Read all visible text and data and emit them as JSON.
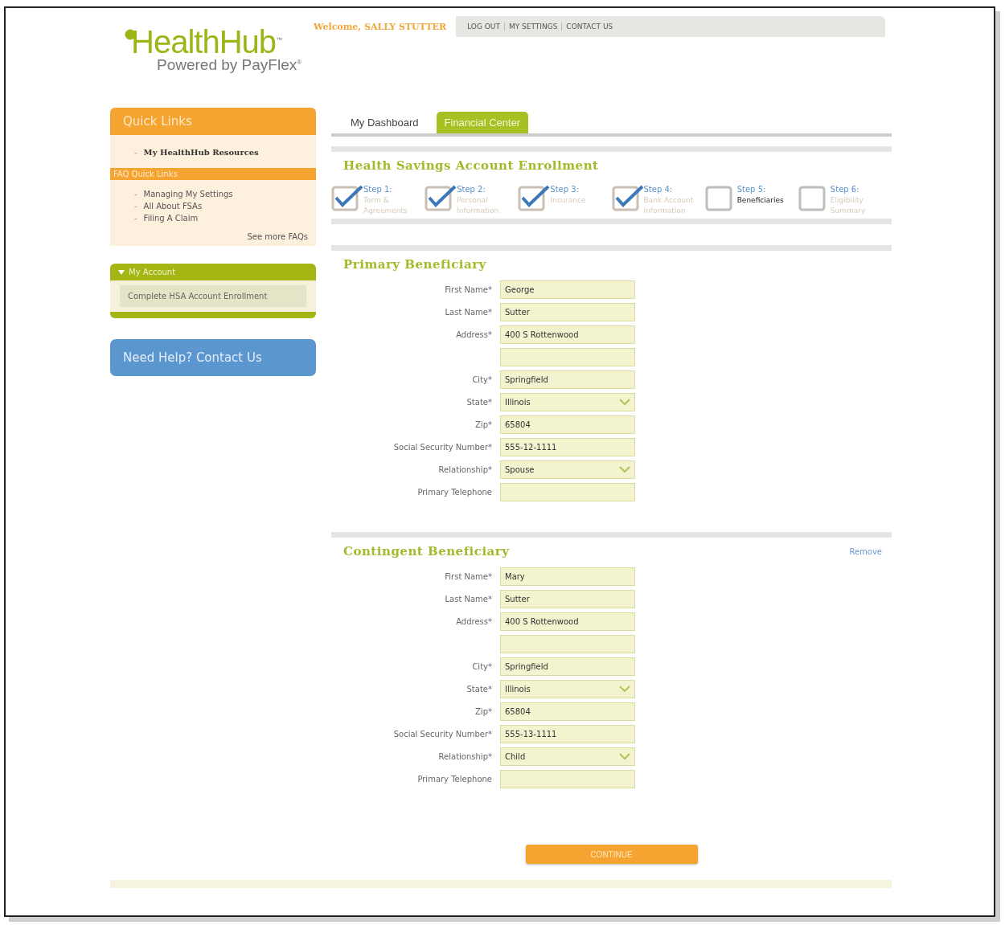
{
  "header": {
    "logo": "HealthHub$^{™}$",
    "tagline": "Powered by PayFlex$^{®}$",
    "welcome": "Welcome, SALLY STUTTER",
    "links": [
      "LOG OUT",
      "MY SETTINGS",
      "CONTACT US"
    ]
  },
  "tabs": [
    {
      "label": "My Dashboard",
      "selected": false
    },
    {
      "label": "Financial Center",
      "selected": true
    }
  ],
  "sidebar": {
    "quick_links": {
      "title": "Quick Links",
      "marker": "-",
      "items": [
        "My HealthHub Resources"
      ],
      "faq_title": "FAQ Quick Links",
      "faq_items": [
        "Managing My Settings",
        "All About FSAs",
        "Filing A Claim"
      ],
      "more": "See more FAQs"
    },
    "my_account": {
      "title": "My Account",
      "expanded": true,
      "items": [
        "Complete HSA Account Enrollment"
      ]
    },
    "help": "Need Help? Contact Us"
  },
  "enrollment": {
    "title": "Health Savings Account Enrollment",
    "steps": [
      {
        "title": "Step 1:",
        "label": "Term & Agreements",
        "checked": true,
        "selected": false
      },
      {
        "title": "Step 2:",
        "label": "Personal Information",
        "checked": true,
        "selected": false
      },
      {
        "title": "Step 3:",
        "label": "Insurance",
        "checked": true,
        "selected": false
      },
      {
        "title": "Step 4:",
        "label": "Bank Account Information",
        "checked": true,
        "selected": false
      },
      {
        "title": "Step 5:",
        "label": "Beneficiaries",
        "checked": false,
        "selected": true
      },
      {
        "title": "Step 6:",
        "label": "Eligibility Summary",
        "checked": false,
        "selected": false
      }
    ]
  },
  "sections": [
    {
      "title": "Primary Beneficiary",
      "fields": [
        {
          "label": "First Name*",
          "kind": "text",
          "value": "George"
        },
        {
          "label": "Last Name*",
          "kind": "text",
          "value": "Sutter"
        },
        {
          "label": "Address*",
          "kind": "text",
          "value": "400 S Rottenwood"
        },
        {
          "kind": "text"
        },
        {
          "label": "City*",
          "kind": "text",
          "value": "Springfield"
        },
        {
          "label": "State*",
          "kind": "select",
          "value": "Illinois"
        },
        {
          "label": "Zip*",
          "kind": "text",
          "value": "65804"
        },
        {
          "label": "Social Security Number*",
          "kind": "text",
          "value": "555-12-1111"
        },
        {
          "label": "Relationship*",
          "kind": "select",
          "value": "Spouse"
        },
        {
          "label": "Primary Telephone",
          "kind": "text"
        }
      ]
    },
    {
      "title": "Contingent Beneficiary",
      "action": "Remove",
      "fields": [
        {
          "label": "First Name*",
          "kind": "text",
          "value": "Mary"
        },
        {
          "label": "Last Name*",
          "kind": "text",
          "value": "Sutter"
        },
        {
          "label": "Address*",
          "kind": "text",
          "value": "400 S Rottenwood"
        },
        {
          "kind": "text"
        },
        {
          "label": "City*",
          "kind": "text",
          "value": "Springfield"
        },
        {
          "label": "State*",
          "kind": "select",
          "value": "Illinois"
        },
        {
          "label": "Zip*",
          "kind": "text",
          "value": "65804"
        },
        {
          "label": "Social Security Number*",
          "kind": "text",
          "value": "555-13-1111"
        },
        {
          "label": "Relationship*",
          "kind": "select",
          "value": "Child"
        },
        {
          "label": "Primary Telephone",
          "kind": "text"
        }
      ]
    }
  ],
  "continue_button": "CONTINUE"
}
